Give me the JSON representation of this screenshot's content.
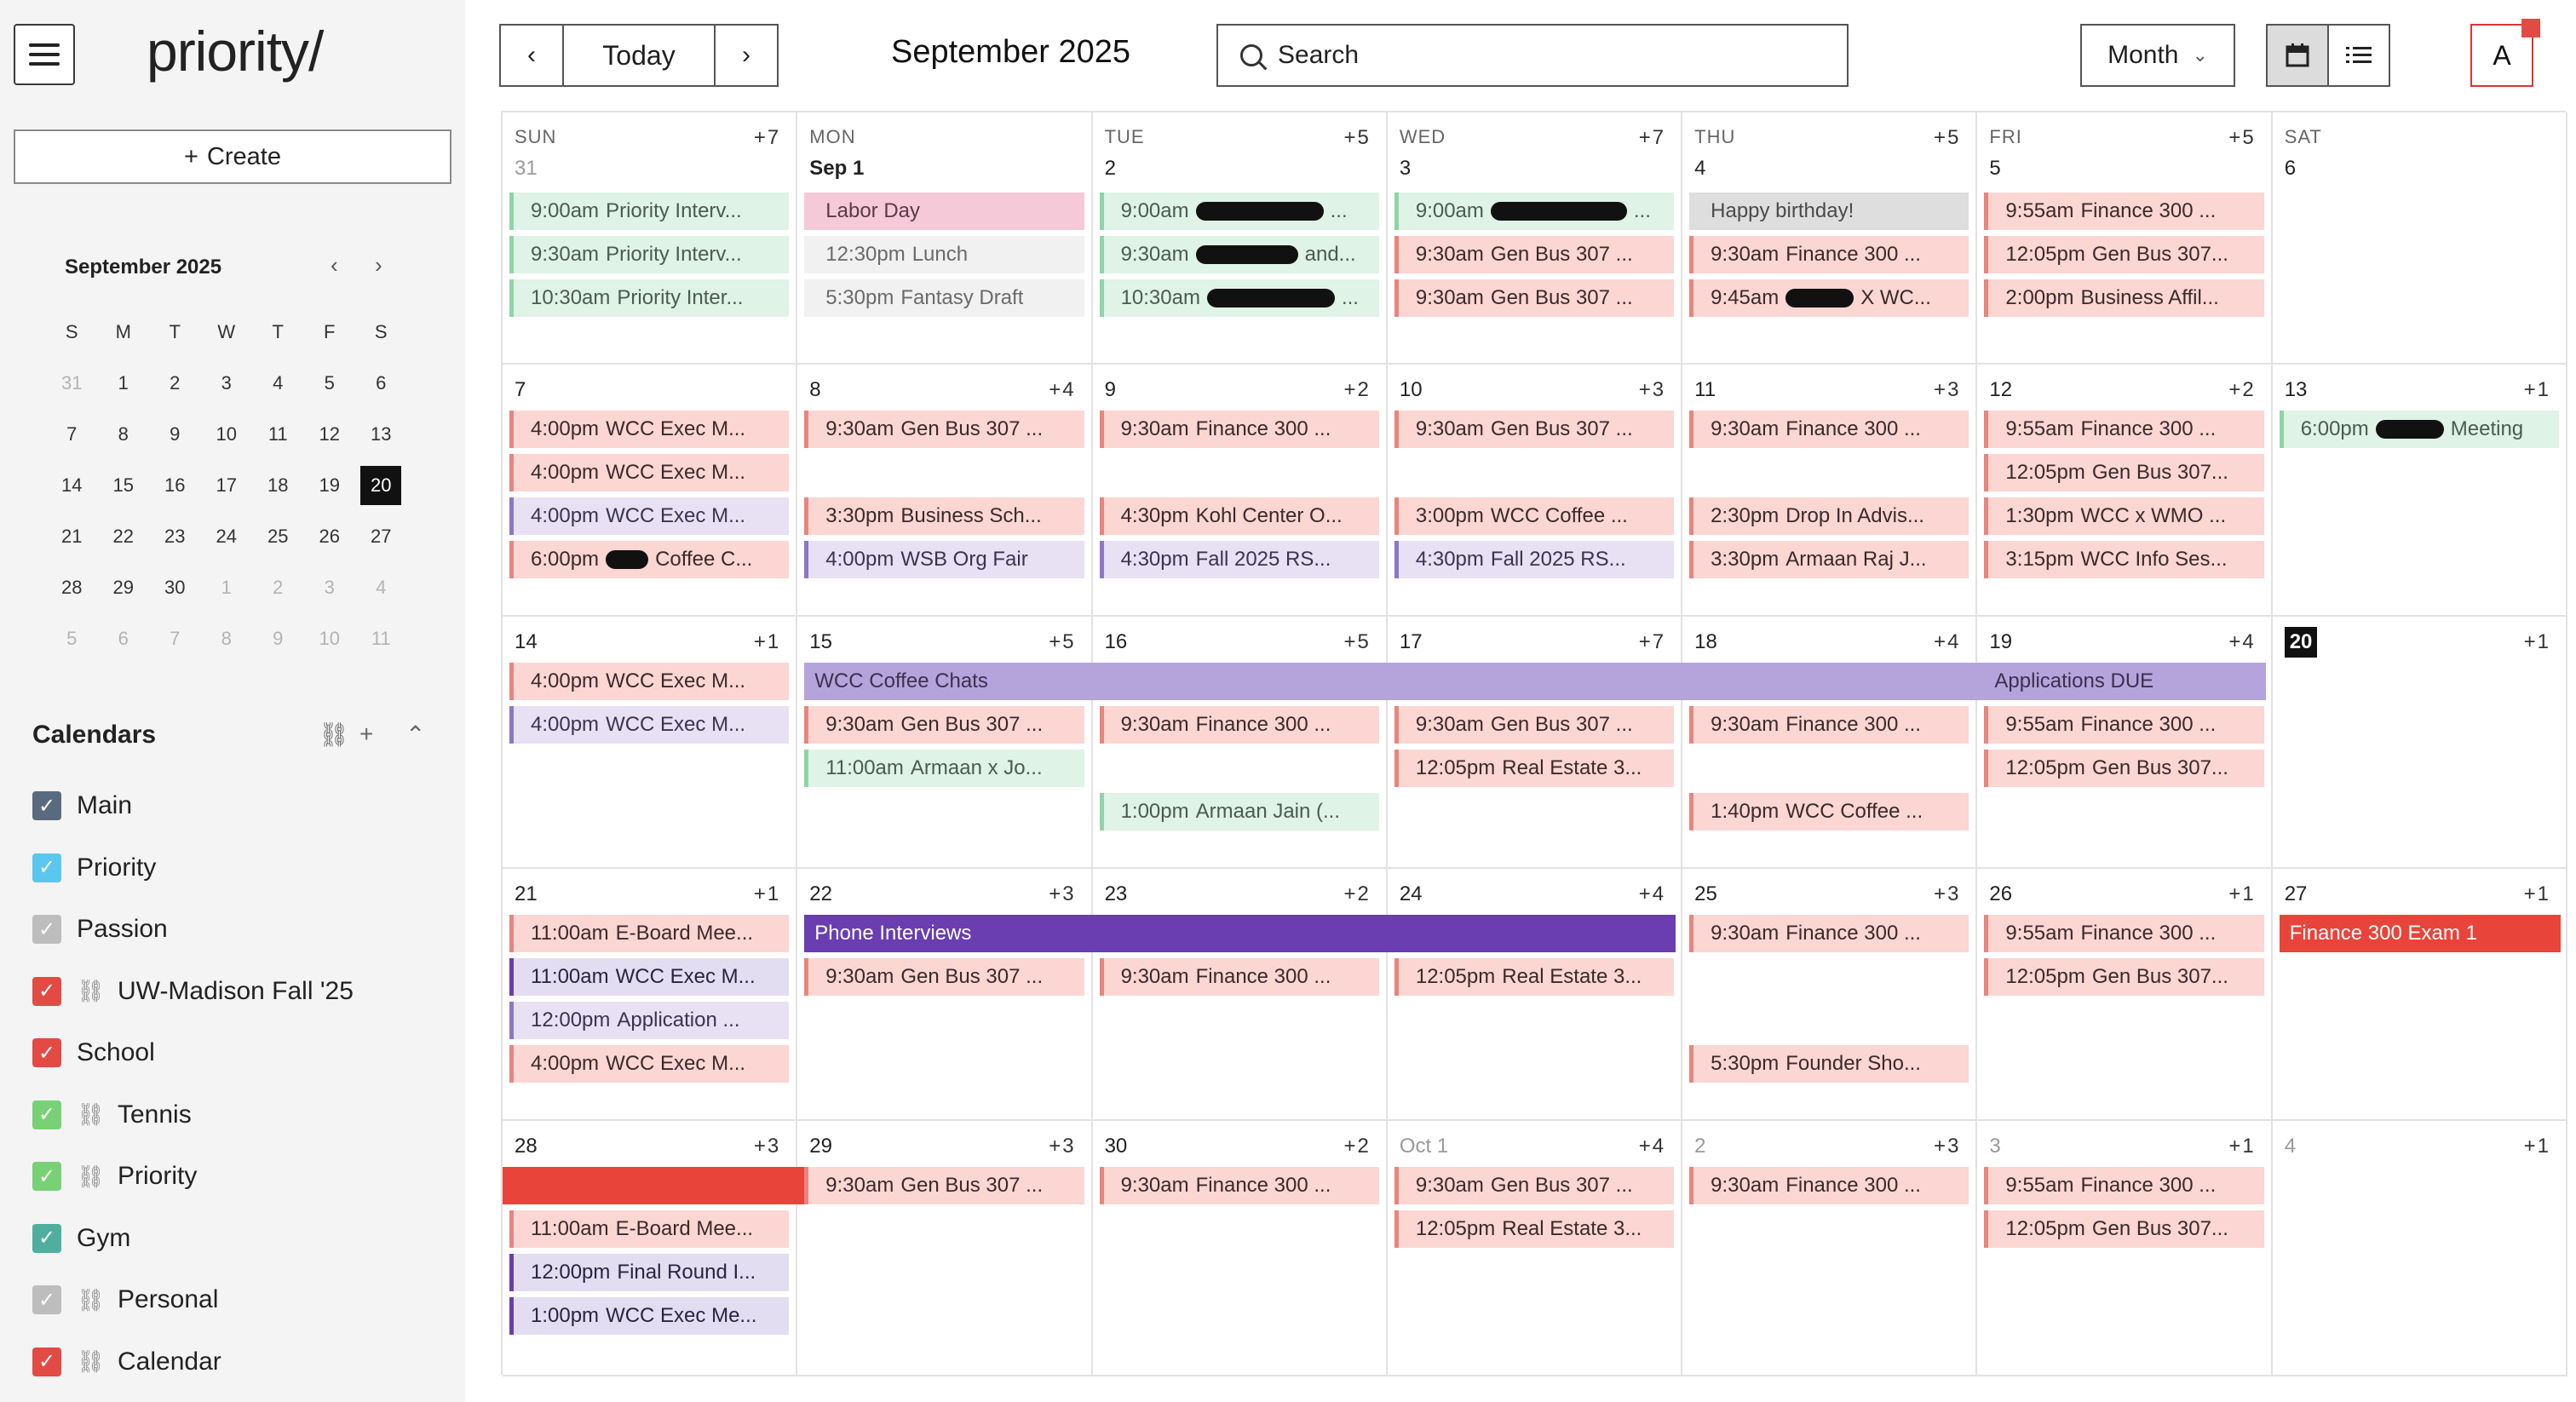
{
  "app": {
    "logo": "priority/"
  },
  "sidebar": {
    "create_label": "Create",
    "mini_calendar": {
      "title": "September 2025",
      "weekdays": [
        "S",
        "M",
        "T",
        "W",
        "T",
        "F",
        "S"
      ],
      "weeks": [
        [
          "31",
          "1",
          "2",
          "3",
          "4",
          "5",
          "6"
        ],
        [
          "7",
          "8",
          "9",
          "10",
          "11",
          "12",
          "13"
        ],
        [
          "14",
          "15",
          "16",
          "17",
          "18",
          "19",
          "20"
        ],
        [
          "21",
          "22",
          "23",
          "24",
          "25",
          "26",
          "27"
        ],
        [
          "28",
          "29",
          "30",
          "1",
          "2",
          "3",
          "4"
        ],
        [
          "5",
          "6",
          "7",
          "8",
          "9",
          "10",
          "11"
        ]
      ],
      "today": "20"
    },
    "calendars_title": "Calendars",
    "calendars": [
      {
        "name": "Main",
        "color": "#5a6a7e",
        "checked": true,
        "linked": false
      },
      {
        "name": "Priority",
        "color": "#5bc7ef",
        "checked": true,
        "linked": false
      },
      {
        "name": "Passion",
        "color": "#bdbdbd",
        "checked": true,
        "linked": false
      },
      {
        "name": "UW-Madison Fall '25",
        "color": "#e24b44",
        "checked": true,
        "linked": true
      },
      {
        "name": "School",
        "color": "#e24b44",
        "checked": true,
        "linked": false
      },
      {
        "name": "Tennis",
        "color": "#78d175",
        "checked": true,
        "linked": true
      },
      {
        "name": "Priority",
        "color": "#78d175",
        "checked": true,
        "linked": true
      },
      {
        "name": "Gym",
        "color": "#4fae9e",
        "checked": true,
        "linked": false
      },
      {
        "name": "Personal",
        "color": "#bdbdbd",
        "checked": true,
        "linked": true
      },
      {
        "name": "Calendar",
        "color": "#e24b44",
        "checked": true,
        "linked": true
      }
    ]
  },
  "toolbar": {
    "today_label": "Today",
    "month_title": "September 2025",
    "search_placeholder": "Search",
    "view_label": "Month",
    "avatar_letter": "A"
  },
  "colors": {
    "green": {
      "bg": "#dff3e6",
      "bar": "#8fd4a6",
      "text": "#4d5a52"
    },
    "red": {
      "bg": "#fbd6d3",
      "bar": "#e8857d",
      "text": "#3a2a2a"
    },
    "purple": {
      "bg": "#e7e1f3",
      "bar": "#8b77c6",
      "text": "#3a3450"
    },
    "pink": {
      "bg": "#f6c9d9",
      "bar": "#f6c9d9",
      "text": "#5a3a46"
    },
    "gray": {
      "bg": "#dedede",
      "bar": "#dedede",
      "text": "#4a4a4a"
    },
    "light": {
      "bg": "#f1f1f1",
      "bar": "#f1f1f1",
      "text": "#6a6a6a"
    },
    "deeppurple": {
      "bg": "#e3ddf2",
      "bar": "#6a3db0",
      "text": "#2a2340"
    },
    "lavender": {
      "bg": "#b5a4db",
      "text": "#3a3050"
    },
    "violet": {
      "bg": "#6a3db0",
      "text": "#ffffff"
    },
    "alert": {
      "bg": "#e8443a",
      "text": "#ffffff"
    }
  },
  "calendar": {
    "weeks": [
      [
        {
          "dow": "SUN",
          "day": "31",
          "muted": true,
          "more": "+7",
          "events": [
            {
              "time": "9:00am",
              "name": "Priority Interv...",
              "c": "green"
            },
            {
              "time": "9:30am",
              "name": "Priority Interv...",
              "c": "green"
            },
            {
              "time": "10:30am",
              "name": "Priority Inter...",
              "c": "green"
            }
          ]
        },
        {
          "dow": "MON",
          "day": "Sep 1",
          "bold": true,
          "events": [
            {
              "time": "",
              "name": "Labor Day",
              "c": "pink"
            },
            {
              "time": "12:30pm",
              "name": "Lunch",
              "c": "light"
            },
            {
              "time": "5:30pm",
              "name": "Fantasy Draft",
              "c": "light"
            }
          ]
        },
        {
          "dow": "TUE",
          "day": "2",
          "more": "+5",
          "events": [
            {
              "time": "9:00am",
              "name": "...",
              "c": "green",
              "blot": 150
            },
            {
              "time": "9:30am",
              "name": "and...",
              "c": "green",
              "blot": 120
            },
            {
              "time": "10:30am",
              "name": "...",
              "c": "green",
              "blot": 150
            }
          ]
        },
        {
          "dow": "WED",
          "day": "3",
          "more": "+7",
          "events": [
            {
              "time": "9:00am",
              "name": "...",
              "c": "green",
              "blot": 160
            },
            {
              "time": "9:30am",
              "name": "Gen Bus 307 ...",
              "c": "red"
            },
            {
              "time": "9:30am",
              "name": "Gen Bus 307 ...",
              "c": "red"
            }
          ]
        },
        {
          "dow": "THU",
          "day": "4",
          "more": "+5",
          "events": [
            {
              "time": "",
              "name": "Happy birthday!",
              "c": "gray"
            },
            {
              "time": "9:30am",
              "name": "Finance 300 ...",
              "c": "red"
            },
            {
              "time": "9:45am",
              "name": "X WC...",
              "c": "red",
              "blot": 80
            }
          ]
        },
        {
          "dow": "FRI",
          "day": "5",
          "more": "+5",
          "events": [
            {
              "time": "9:55am",
              "name": "Finance 300 ...",
              "c": "red"
            },
            {
              "time": "12:05pm",
              "name": "Gen Bus 307...",
              "c": "red"
            },
            {
              "time": "2:00pm",
              "name": "Business Affil...",
              "c": "red"
            }
          ]
        },
        {
          "dow": "SAT",
          "day": "6",
          "events": []
        }
      ],
      [
        {
          "day": "7",
          "events": [
            {
              "time": "4:00pm",
              "name": "WCC Exec M...",
              "c": "red"
            },
            {
              "time": "4:00pm",
              "name": "WCC Exec M...",
              "c": "red"
            },
            {
              "time": "4:00pm",
              "name": "WCC Exec M...",
              "c": "purple"
            },
            {
              "time": "6:00pm",
              "name": "Coffee C...",
              "c": "red",
              "blot": 50
            }
          ]
        },
        {
          "day": "8",
          "more": "+4",
          "events": [
            {
              "time": "9:30am",
              "name": "Gen Bus 307 ...",
              "c": "red"
            },
            null,
            {
              "time": "3:30pm",
              "name": "Business Sch...",
              "c": "red"
            },
            {
              "time": "4:00pm",
              "name": "WSB Org Fair",
              "c": "purple"
            }
          ]
        },
        {
          "day": "9",
          "more": "+2",
          "events": [
            {
              "time": "9:30am",
              "name": "Finance 300 ...",
              "c": "red"
            },
            null,
            {
              "time": "4:30pm",
              "name": "Kohl Center O...",
              "c": "red"
            },
            {
              "time": "4:30pm",
              "name": "Fall 2025 RS...",
              "c": "purple"
            }
          ]
        },
        {
          "day": "10",
          "more": "+3",
          "events": [
            {
              "time": "9:30am",
              "name": "Gen Bus 307 ...",
              "c": "red"
            },
            null,
            {
              "time": "3:00pm",
              "name": "WCC Coffee ...",
              "c": "red"
            },
            {
              "time": "4:30pm",
              "name": "Fall 2025 RS...",
              "c": "purple"
            }
          ]
        },
        {
          "day": "11",
          "more": "+3",
          "events": [
            {
              "time": "9:30am",
              "name": "Finance 300 ...",
              "c": "red"
            },
            null,
            {
              "time": "2:30pm",
              "name": "Drop In Advis...",
              "c": "red"
            },
            {
              "time": "3:30pm",
              "name": "Armaan Raj J...",
              "c": "red"
            }
          ]
        },
        {
          "day": "12",
          "more": "+2",
          "events": [
            {
              "time": "9:55am",
              "name": "Finance 300 ...",
              "c": "red"
            },
            {
              "time": "12:05pm",
              "name": "Gen Bus 307...",
              "c": "red"
            },
            {
              "time": "1:30pm",
              "name": "WCC x WMO ...",
              "c": "red"
            },
            {
              "time": "3:15pm",
              "name": "WCC Info Ses...",
              "c": "red"
            }
          ]
        },
        {
          "day": "13",
          "more": "+1",
          "events": [
            {
              "time": "6:00pm",
              "name": "Meeting",
              "c": "green",
              "blot": 80
            }
          ]
        }
      ],
      [
        {
          "day": "14",
          "more": "+1",
          "events": [
            {
              "time": "4:00pm",
              "name": "WCC Exec M...",
              "c": "red"
            },
            {
              "time": "4:00pm",
              "name": "WCC Exec M...",
              "c": "purple"
            }
          ]
        },
        {
          "day": "15",
          "more": "+5",
          "events": [
            null,
            {
              "time": "9:30am",
              "name": "Gen Bus 307 ...",
              "c": "red"
            },
            {
              "time": "11:00am",
              "name": "Armaan x Jo...",
              "c": "green"
            }
          ]
        },
        {
          "day": "16",
          "more": "+5",
          "events": [
            null,
            {
              "time": "9:30am",
              "name": "Finance 300 ...",
              "c": "red"
            },
            null,
            {
              "time": "1:00pm",
              "name": "Armaan Jain (...",
              "c": "green"
            }
          ]
        },
        {
          "day": "17",
          "more": "+7",
          "events": [
            null,
            {
              "time": "9:30am",
              "name": "Gen Bus 307 ...",
              "c": "red"
            },
            {
              "time": "12:05pm",
              "name": "Real Estate 3...",
              "c": "red"
            }
          ]
        },
        {
          "day": "18",
          "more": "+4",
          "events": [
            null,
            {
              "time": "9:30am",
              "name": "Finance 300 ...",
              "c": "red"
            },
            null,
            {
              "time": "1:40pm",
              "name": "WCC Coffee ...",
              "c": "red"
            }
          ]
        },
        {
          "day": "19",
          "more": "+4",
          "events": [
            null,
            {
              "time": "9:55am",
              "name": "Finance 300 ...",
              "c": "red"
            },
            {
              "time": "12:05pm",
              "name": "Gen Bus 307...",
              "c": "red"
            }
          ]
        },
        {
          "day": "20",
          "today": true,
          "more": "+1",
          "events": []
        }
      ],
      [
        {
          "day": "21",
          "more": "+1",
          "events": [
            {
              "time": "11:00am",
              "name": "E-Board Mee...",
              "c": "red"
            },
            {
              "time": "11:00am",
              "name": "WCC Exec M...",
              "c": "deeppurple"
            },
            {
              "time": "12:00pm",
              "name": "Application ...",
              "c": "purple"
            },
            {
              "time": "4:00pm",
              "name": "WCC Exec M...",
              "c": "red"
            }
          ]
        },
        {
          "day": "22",
          "more": "+3",
          "events": [
            null,
            {
              "time": "9:30am",
              "name": "Gen Bus 307 ...",
              "c": "red"
            }
          ]
        },
        {
          "day": "23",
          "more": "+2",
          "events": [
            null,
            {
              "time": "9:30am",
              "name": "Finance 300 ...",
              "c": "red"
            }
          ]
        },
        {
          "day": "24",
          "more": "+4",
          "events": [
            null,
            {
              "time": "12:05pm",
              "name": "Real Estate 3...",
              "c": "red"
            }
          ]
        },
        {
          "day": "25",
          "more": "+3",
          "events": [
            {
              "time": "9:30am",
              "name": "Finance 300 ...",
              "c": "red"
            },
            null,
            null,
            {
              "time": "5:30pm",
              "name": "Founder Sho...",
              "c": "red"
            }
          ]
        },
        {
          "day": "26",
          "more": "+1",
          "events": [
            {
              "time": "9:55am",
              "name": "Finance 300 ...",
              "c": "red"
            },
            {
              "time": "12:05pm",
              "name": "Gen Bus 307...",
              "c": "red"
            }
          ]
        },
        {
          "day": "27",
          "more": "+1",
          "events": []
        }
      ],
      [
        {
          "day": "28",
          "more": "+3",
          "events": [
            null,
            {
              "time": "11:00am",
              "name": "E-Board Mee...",
              "c": "red"
            },
            {
              "time": "12:00pm",
              "name": "Final Round I...",
              "c": "deeppurple"
            },
            {
              "time": "1:00pm",
              "name": "WCC Exec Me...",
              "c": "deeppurple"
            }
          ]
        },
        {
          "day": "29",
          "more": "+3",
          "events": [
            {
              "time": "9:30am",
              "name": "Gen Bus 307 ...",
              "c": "red"
            }
          ]
        },
        {
          "day": "30",
          "more": "+2",
          "events": [
            {
              "time": "9:30am",
              "name": "Finance 300 ...",
              "c": "red"
            }
          ]
        },
        {
          "day": "Oct 1",
          "muted": true,
          "more": "+4",
          "events": [
            {
              "time": "9:30am",
              "name": "Gen Bus 307 ...",
              "c": "red"
            },
            {
              "time": "12:05pm",
              "name": "Real Estate 3...",
              "c": "red"
            }
          ]
        },
        {
          "day": "2",
          "muted": true,
          "more": "+3",
          "events": [
            {
              "time": "9:30am",
              "name": "Finance 300 ...",
              "c": "red"
            }
          ]
        },
        {
          "day": "3",
          "muted": true,
          "more": "+1",
          "events": [
            {
              "time": "9:55am",
              "name": "Finance 300 ...",
              "c": "red"
            },
            {
              "time": "12:05pm",
              "name": "Gen Bus 307...",
              "c": "red"
            }
          ]
        },
        {
          "day": "4",
          "muted": true,
          "more": "+1",
          "events": []
        }
      ]
    ],
    "spans": [
      {
        "week": 2,
        "start": 1,
        "end": 5,
        "slot": 0,
        "label": "WCC Coffee Chats",
        "c": "lavender"
      },
      {
        "week": 2,
        "start": 5,
        "end": 5,
        "slot": 0,
        "label": "Applications DUE",
        "c": "lavender",
        "overlay": true
      },
      {
        "week": 3,
        "start": 1,
        "end": 3,
        "slot": 0,
        "label": "Phone Interviews",
        "c": "violet"
      },
      {
        "week": 3,
        "start": 6,
        "end": 6,
        "slot": 0,
        "label": "Finance 300 Exam 1",
        "c": "alert"
      },
      {
        "week": 4,
        "start": 0,
        "end": 0,
        "slot": 0,
        "label": "",
        "c": "alert"
      }
    ]
  }
}
